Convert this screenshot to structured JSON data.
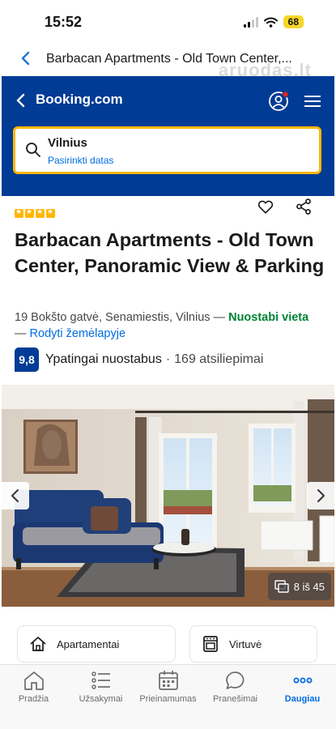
{
  "status_bar": {
    "time": "15:52",
    "battery": "68"
  },
  "browser": {
    "title": "Barbacan Apartments - Old Town Center,...",
    "watermark": "aruodas.lt"
  },
  "header": {
    "logo": "Booking.com"
  },
  "search": {
    "city": "Vilnius",
    "dates": "Pasirinkti datas"
  },
  "property": {
    "star_count": 4,
    "title": "Barbacan Apartments - Old Town Center, Panoramic View & Parking",
    "address": "19 Bokšto gatvė, Senamiestis, Vilnius",
    "dash1": " — ",
    "location_badge": "Nuostabi vieta",
    "dash2": "— ",
    "map_link": "Rodyti žemėlapyje",
    "score": "9,8",
    "score_label": "Ypatingai nuostabus",
    "score_sep": "·",
    "reviews": "169 atsiliepimai"
  },
  "gallery": {
    "counter": "8 iš 45"
  },
  "facilities": [
    {
      "label": "Apartamentai",
      "icon": "house-icon"
    },
    {
      "label": "Virtuvė",
      "icon": "oven-icon"
    }
  ],
  "nav": [
    {
      "label": "Pradžia",
      "icon": "home-icon"
    },
    {
      "label": "Užsakymai",
      "icon": "list-icon"
    },
    {
      "label": "Prieinamumas",
      "icon": "calendar-icon"
    },
    {
      "label": "Pranešimai",
      "icon": "chat-icon"
    },
    {
      "label": "Daugiau",
      "icon": "more-icon"
    }
  ],
  "colors": {
    "brand": "#003b95",
    "accent": "#ffb700",
    "link": "#006ce4",
    "positive": "#008234"
  }
}
